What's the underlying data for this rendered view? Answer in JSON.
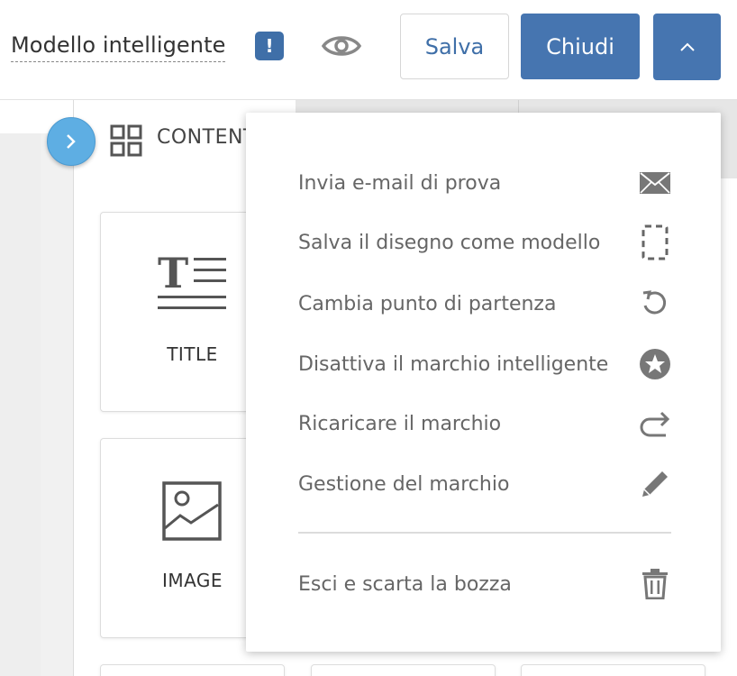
{
  "header": {
    "template_name": "Modello intelligente",
    "alert_badge": "!",
    "save_label": "Salva",
    "close_label": "Chiudi"
  },
  "sidebar": {
    "section_title": "CONTENT",
    "blocks": [
      {
        "label": "TITLE",
        "icon": "title-text-icon"
      },
      {
        "label": "IMAGE",
        "icon": "image-icon"
      }
    ]
  },
  "menu": {
    "items": [
      {
        "label": "Invia e-mail di prova",
        "icon": "envelope-icon"
      },
      {
        "label": "Salva il disegno come modello",
        "icon": "dashed-template-icon"
      },
      {
        "label": "Cambia punto di partenza",
        "icon": "undo-icon"
      },
      {
        "label": "Disattiva il marchio intelligente",
        "icon": "star-circle-icon"
      },
      {
        "label": "Ricaricare il marchio",
        "icon": "redo-arrow-icon"
      },
      {
        "label": "Gestione del marchio",
        "icon": "pencil-icon"
      }
    ],
    "footer_item": {
      "label": "Esci e scarta la bozza",
      "icon": "trash-icon"
    }
  },
  "colors": {
    "primary": "#4675b0",
    "badge": "#3f6fa8",
    "collapse_button": "#5eaee3",
    "icon_gray": "#777777"
  }
}
